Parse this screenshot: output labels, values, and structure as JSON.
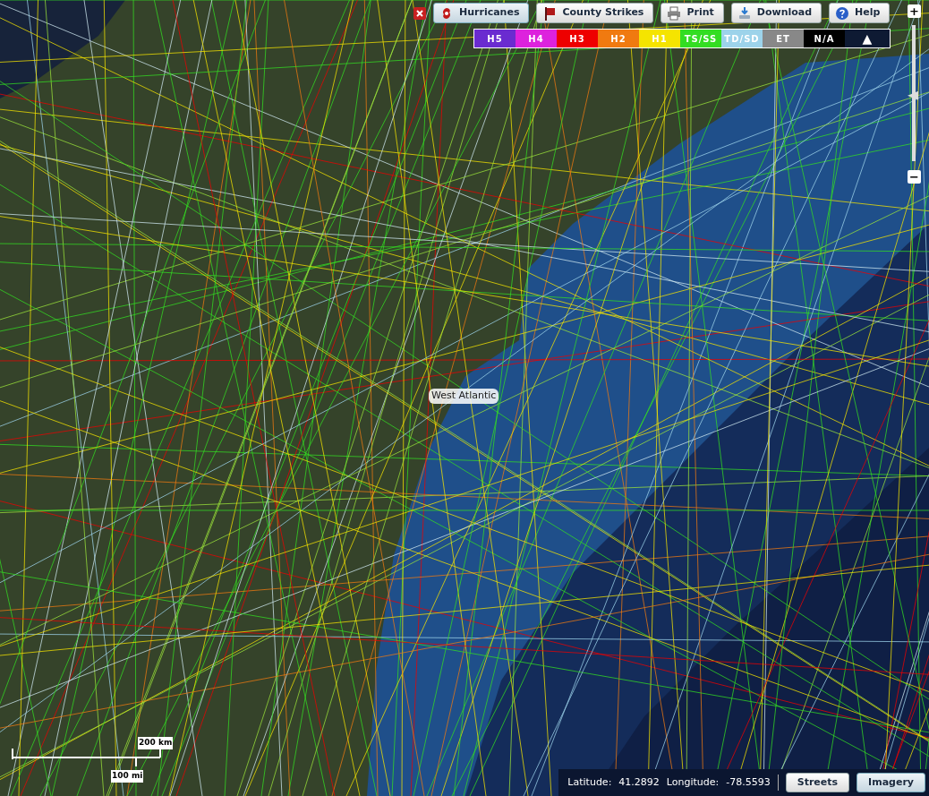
{
  "toolbar": {
    "buttons": [
      {
        "kind": "hurricanes",
        "label": "Hurricanes",
        "selected": true
      },
      {
        "kind": "county",
        "label": "County Strikes",
        "selected": false
      },
      {
        "kind": "print",
        "label": "Print",
        "selected": false
      },
      {
        "kind": "download",
        "label": "Download",
        "selected": false
      },
      {
        "kind": "help",
        "label": "Help",
        "selected": false
      }
    ]
  },
  "legend": {
    "categories": [
      {
        "label": "H5",
        "color": "#6a2bd0"
      },
      {
        "label": "H4",
        "color": "#dd22dd"
      },
      {
        "label": "H3",
        "color": "#ee0000"
      },
      {
        "label": "H2",
        "color": "#f07a10"
      },
      {
        "label": "H1",
        "color": "#f5e400"
      },
      {
        "label": "TS/SS",
        "color": "#33dd22"
      },
      {
        "label": "TD/SD",
        "color": "#9dd3ea"
      },
      {
        "label": "ET",
        "color": "#888888"
      },
      {
        "label": "N/A",
        "color": "#000000"
      }
    ],
    "toggle": "▲"
  },
  "zoom": {
    "plus": "+",
    "minus": "−",
    "level": 0.48
  },
  "map": {
    "label": "West Atlantic"
  },
  "scale": {
    "km": "200 km",
    "mi": "100 mi"
  },
  "status": {
    "lat_label": "Latitude:",
    "lat": "41.2892",
    "lon_label": "Longitude:",
    "lon": "-78.5593"
  },
  "base_layers": [
    {
      "label": "Streets",
      "selected": false
    },
    {
      "label": "Imagery",
      "selected": true
    }
  ]
}
